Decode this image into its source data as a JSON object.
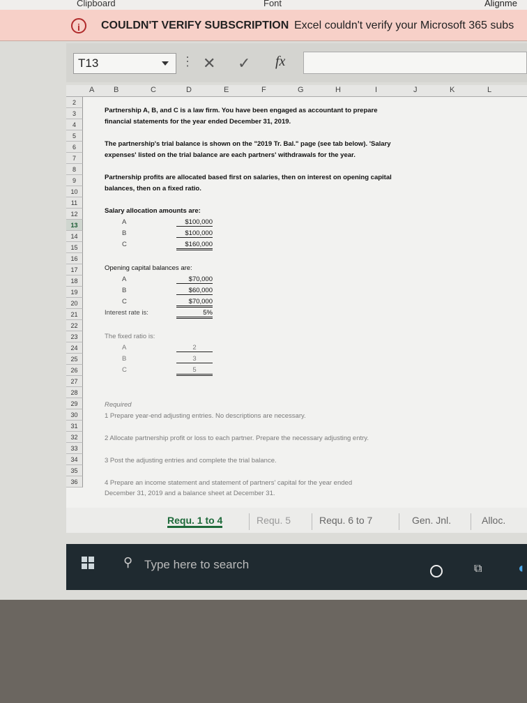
{
  "ribbon": {
    "labels": [
      "Clipboard",
      "Font",
      "Alignme"
    ]
  },
  "warning": {
    "icon": "info-icon",
    "title": "COULDN'T VERIFY SUBSCRIPTION",
    "message": "Excel couldn't verify your Microsoft 365 subs"
  },
  "formula_bar": {
    "name_box": "T13",
    "cancel": "✕",
    "enter": "✓",
    "fx": "fx",
    "formula": ""
  },
  "columns": [
    "A",
    "B",
    "C",
    "D",
    "E",
    "F",
    "G",
    "H",
    "I",
    "J",
    "K",
    "L"
  ],
  "rows": [
    "2",
    "3",
    "4",
    "5",
    "6",
    "7",
    "8",
    "9",
    "10",
    "11",
    "12",
    "13",
    "14",
    "15",
    "16",
    "17",
    "18",
    "19",
    "20",
    "21",
    "22",
    "23",
    "24",
    "25",
    "26",
    "27",
    "28",
    "29",
    "30",
    "31",
    "32",
    "33",
    "34",
    "35",
    "36"
  ],
  "selected_row": "13",
  "content": {
    "intro_1": "Partnership A, B, and C is a law firm. You have been engaged as accountant to prepare",
    "intro_2": "financial statements for the year ended December 31, 2019.",
    "tb_1": "The partnership's trial balance is shown on the \"2019 Tr. Bal.\" page (see tab below). 'Salary",
    "tb_2": "expenses' listed on the trial balance are each partners' withdrawals for the year.",
    "alloc_1": "Partnership profits are allocated based first on salaries, then on interest on opening capital",
    "alloc_2": "balances, then on a fixed ratio.",
    "salary_heading": "Salary allocation amounts are:",
    "salary": [
      {
        "partner": "A",
        "amount": "$100,000"
      },
      {
        "partner": "B",
        "amount": "$100,000"
      },
      {
        "partner": "C",
        "amount": "$160,000"
      }
    ],
    "capital_heading": "Opening capital balances are:",
    "capital": [
      {
        "partner": "A",
        "amount": "$70,000"
      },
      {
        "partner": "B",
        "amount": "$60,000"
      },
      {
        "partner": "C",
        "amount": "$70,000"
      }
    ],
    "interest_label": "Interest rate is:",
    "interest_value": "5%",
    "ratio_heading": "The fixed ratio is:",
    "ratio": [
      {
        "partner": "A",
        "value": "2"
      },
      {
        "partner": "B",
        "value": "3"
      },
      {
        "partner": "C",
        "value": "5"
      }
    ],
    "required": "Required",
    "req_1": "1 Prepare year-end adjusting entries. No descriptions are necessary.",
    "req_2": "2 Allocate partnership profit or loss to each partner. Prepare the necessary adjusting entry.",
    "req_3": "3 Post the adjusting entries and complete the trial balance.",
    "req_4a": "4 Prepare an income statement and statement of partners' capital for the year ended",
    "req_4b": "December 31, 2019 and a balance sheet at December 31."
  },
  "tabs": [
    "Requ. 1 to 4",
    "Requ. 5",
    "Requ. 6 to 7",
    "Gen. Jnl.",
    "Alloc."
  ],
  "active_tab": "Requ. 1 to 4",
  "taskbar": {
    "search_placeholder": "Type here to search",
    "start_icon": "windows-icon",
    "search_icon": "search-icon"
  }
}
